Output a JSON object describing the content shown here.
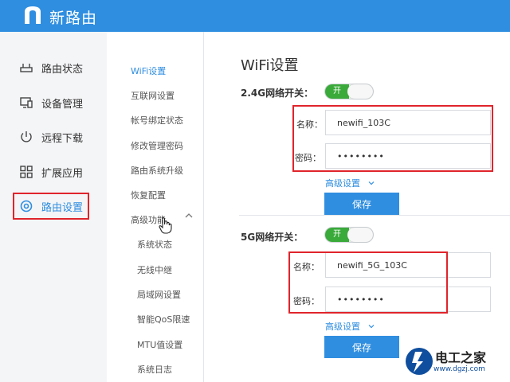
{
  "app": {
    "brand": "新路由"
  },
  "sidebar": {
    "items": [
      {
        "label": "路由状态",
        "icon": "router-icon"
      },
      {
        "label": "设备管理",
        "icon": "devices-icon"
      },
      {
        "label": "远程下载",
        "icon": "power-download-icon"
      },
      {
        "label": "扩展应用",
        "icon": "grid-apps-icon"
      },
      {
        "label": "路由设置",
        "icon": "settings-ring-icon",
        "active": true
      }
    ]
  },
  "submenu": {
    "items": [
      {
        "label": "WiFi设置",
        "active": true
      },
      {
        "label": "互联网设置"
      },
      {
        "label": "帐号绑定状态"
      },
      {
        "label": "修改管理密码"
      },
      {
        "label": "路由系统升级"
      },
      {
        "label": "恢复配置"
      },
      {
        "label": "高级功能",
        "expanded": true
      }
    ],
    "children": [
      {
        "label": "系统状态"
      },
      {
        "label": "无线中继"
      },
      {
        "label": "局域网设置"
      },
      {
        "label": "智能QoS限速"
      },
      {
        "label": "MTU值设置"
      },
      {
        "label": "系统日志"
      }
    ]
  },
  "main": {
    "title": "WiFi设置",
    "band24": {
      "switch_label": "2.4G网络开关：",
      "switch_on": "开",
      "name_label": "名称：",
      "name_value": "newifi_103C",
      "password_label": "密码：",
      "password_value": "••••••••",
      "advanced_label": "高级设置",
      "save_label": "保存"
    },
    "band5": {
      "switch_label": "5G网络开关：",
      "switch_on": "开",
      "name_label": "名称：",
      "name_value": "newifi_5G_103C",
      "password_label": "密码：",
      "password_value": "••••••••",
      "advanced_label": "高级设置",
      "save_label": "保存"
    }
  },
  "watermark": {
    "text": "电工之家",
    "url": "www.dgzj.com"
  },
  "colors": {
    "header": "#2f8ee0",
    "accent": "#2f8ee0",
    "toggle_on": "#3aaa3a",
    "highlight": "#e0242b"
  }
}
